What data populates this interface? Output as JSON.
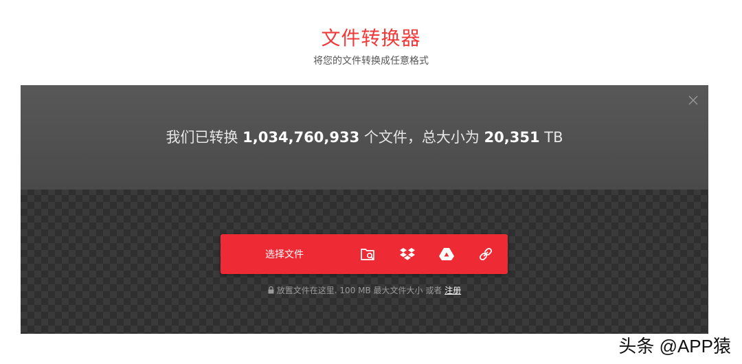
{
  "header": {
    "title": "文件转换器",
    "subtitle": "将您的文件转换成任意格式"
  },
  "stats": {
    "prefix": "我们已转换 ",
    "files_count": "1,034,760,933",
    "middle": " 个文件，总大小为 ",
    "total_size": "20,351",
    "unit": " TB"
  },
  "uploader": {
    "choose_label": "选择文件",
    "icons": [
      "folder-search-icon",
      "dropbox-icon",
      "google-drive-icon",
      "link-icon"
    ]
  },
  "hint": {
    "text": "放置文件在这里. 100 MB 最大文件大小 或者 ",
    "signup_label": "注册"
  },
  "watermark": "头条 @APP猿",
  "colors": {
    "accent": "#ee2b35",
    "title": "#f03a3a"
  }
}
